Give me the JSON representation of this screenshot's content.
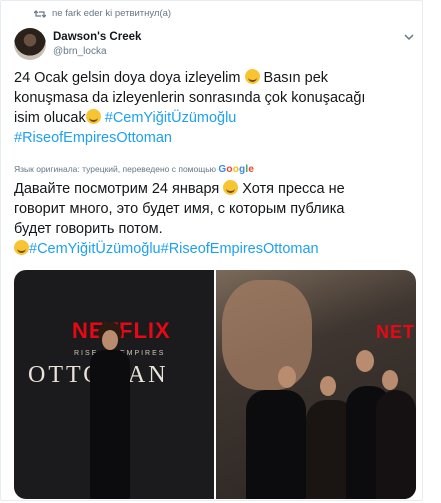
{
  "retweet": {
    "text": "ne fark eder ki ретвитнул(а)"
  },
  "author": {
    "name": "Dawson's Creek",
    "handle": "@brn_locka"
  },
  "tweet": {
    "line1": "24 Ocak gelsin doya doya izleyelim",
    "line1b": " Basın pek",
    "line2": "konuşmasa da izleyenlerin sonrasında çok konuşacağı",
    "line3": "isim olucak",
    "tag1": "#CemYiğitÜzümoğlu",
    "tag2": "#RiseofEmpiresOttoman"
  },
  "translation": {
    "meta": "Язык оригинала: турецкий, переведено с помощью",
    "google": [
      "G",
      "o",
      "o",
      "g",
      "l",
      "e"
    ],
    "line1": "Давайте посмотрим 24 января",
    "line1b": " Хотя пресса не",
    "line2": "говорит много, это будет имя, с которым публика",
    "line3": "будет говорить потом.",
    "tag1": "#CemYiğitÜzümoğlu",
    "tag2": "#RiseofEmpiresOttoman"
  },
  "media": {
    "photo1": {
      "brand": "NETFLIX",
      "subtitle": "RISE OF EMPIRES",
      "title": "OTTOMAN"
    },
    "photo2": {
      "brand": "NETF"
    }
  },
  "colors": {
    "link": "#1da1f2",
    "netflix": "#e50914",
    "muted": "#657786"
  },
  "icons": [
    "retweet-icon",
    "chevron-down-icon",
    "smiling-face-icon"
  ]
}
